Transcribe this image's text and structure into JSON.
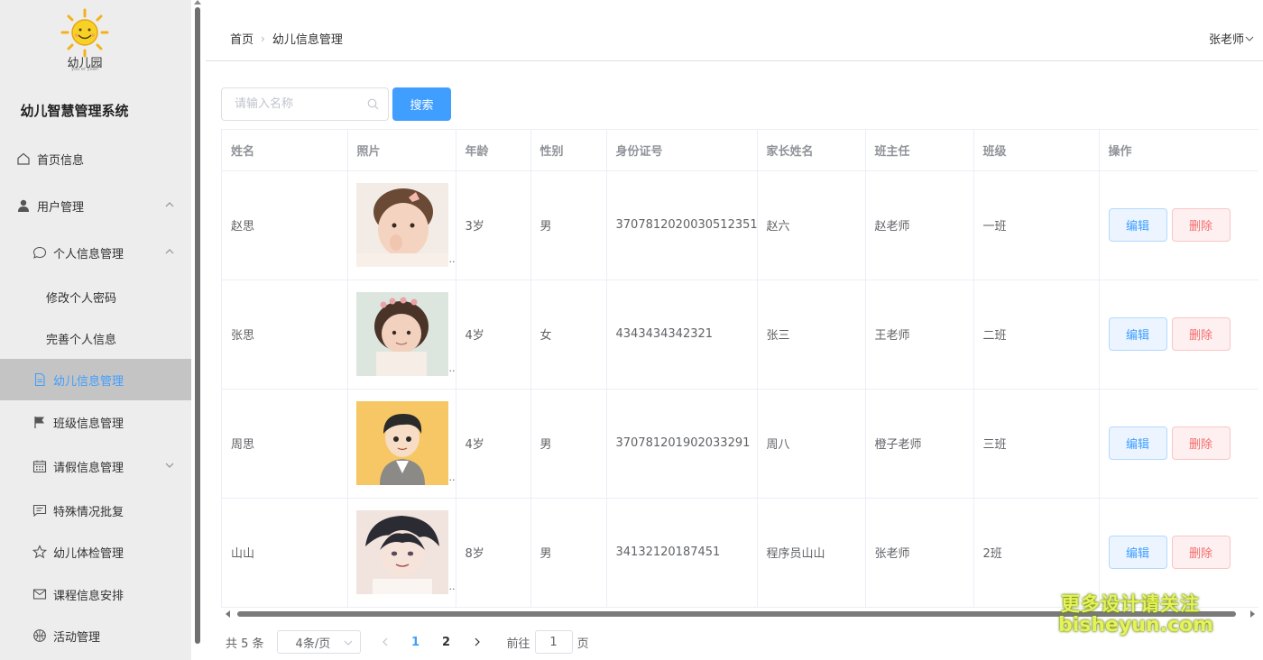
{
  "sidebar": {
    "logo_text": "幼儿园",
    "logo_sub": "you er yuan",
    "system_title": "幼儿智慧管理系统",
    "items": [
      {
        "label": "首页信息"
      },
      {
        "label": "用户管理"
      },
      {
        "label": "个人信息管理"
      },
      {
        "label": "修改个人密码"
      },
      {
        "label": "完善个人信息"
      },
      {
        "label": "幼儿信息管理"
      },
      {
        "label": "班级信息管理"
      },
      {
        "label": "请假信息管理"
      },
      {
        "label": "特殊情况批复"
      },
      {
        "label": "幼儿体检管理"
      },
      {
        "label": "课程信息安排"
      },
      {
        "label": "活动管理"
      }
    ],
    "active_item": "幼儿信息管理",
    "accent_color": "#409eff"
  },
  "header": {
    "breadcrumb": [
      "首页",
      "幼儿信息管理"
    ],
    "user": "张老师"
  },
  "search": {
    "placeholder": "请输入名称",
    "value": "",
    "button_label": "搜索"
  },
  "table": {
    "columns": [
      "姓名",
      "照片",
      "年龄",
      "性别",
      "身份证号",
      "家长姓名",
      "班主任",
      "班级",
      "操作"
    ],
    "rows": [
      {
        "name": "赵思",
        "photo": "baby-photo-1",
        "age": "3岁",
        "gender": "男",
        "id_number": "3707812020030512351",
        "parent": "赵六",
        "teacher": "赵老师",
        "class": "一班"
      },
      {
        "name": "张思",
        "photo": "baby-photo-2",
        "age": "4岁",
        "gender": "女",
        "id_number": "4343434342321",
        "parent": "张三",
        "teacher": "王老师",
        "class": "二班"
      },
      {
        "name": "周思",
        "photo": "cartoon-avatar",
        "age": "4岁",
        "gender": "男",
        "id_number": "370781201902033291",
        "parent": "周八",
        "teacher": "橙子老师",
        "class": "三班"
      },
      {
        "name": "山山",
        "photo": "anime-avatar",
        "age": "8岁",
        "gender": "男",
        "id_number": "34132120187451",
        "parent": "程序员山山",
        "teacher": "张老师",
        "class": "2班"
      }
    ],
    "edit_label": "编辑",
    "delete_label": "删除",
    "ellipsis": ".."
  },
  "pagination": {
    "total_text": "共 5 条",
    "page_size_text": "4条/页",
    "pages": [
      "1",
      "2"
    ],
    "current_page": "1",
    "goto_prefix": "前往",
    "goto_value": "1",
    "goto_suffix": "页"
  },
  "watermark": {
    "line1": "更多设计请关注",
    "line2": "bisheyun.com"
  }
}
